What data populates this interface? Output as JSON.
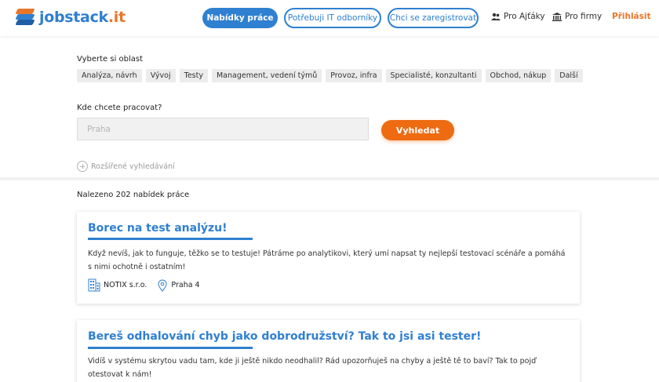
{
  "header": {
    "logo_text": "jobstack",
    "logo_suffix": ".it",
    "nav_primary": "Nabídky práce",
    "nav_it": "Potřebuji IT odborníky",
    "nav_register": "Chci se zaregistrovat",
    "link_ajtaky": "Pro Ajťáky",
    "link_firmy": "Pro firmy",
    "link_login": "Přihlásit"
  },
  "search": {
    "area_label": "Vyberte si oblast",
    "tags": [
      "Analýza, návrh",
      "Vývoj",
      "Testy",
      "Management, vedení týmů",
      "Provoz, infra",
      "Specialisté, konzultanti",
      "Obchod, nákup",
      "Další"
    ],
    "where_label": "Kde chcete pracovat?",
    "where_placeholder": "Praha",
    "search_button": "Vyhledat",
    "advanced": "Rozšířené vyhledávání"
  },
  "results": {
    "found_text": "Nalezeno 202 nabídek práce",
    "jobs": [
      {
        "title": "Borec na test analýzu!",
        "desc_line1": "Když nevíš, jak to funguje, těžko se to testuje! Pátráme po analytikovi, který umí napsat ty nejlepší testovací scénáře a pomáhá",
        "desc_line2": "s nimi ochotně i ostatním!",
        "company": "NOTIX s.r.o.",
        "location": "Praha 4"
      },
      {
        "title": "Bereš odhalování chyb jako dobrodružství? Tak to jsi asi tester!",
        "desc_line1": "Vidíš v systému skrytou vadu tam, kde ji ještě nikdo neodhalil? Rád upozorňuješ na chyby a ještě tě to baví? Tak to pojď",
        "desc_line2": "otestovat k nám!"
      }
    ]
  },
  "colors": {
    "brand_blue": "#2f80d0",
    "brand_orange": "#ee6b12"
  }
}
